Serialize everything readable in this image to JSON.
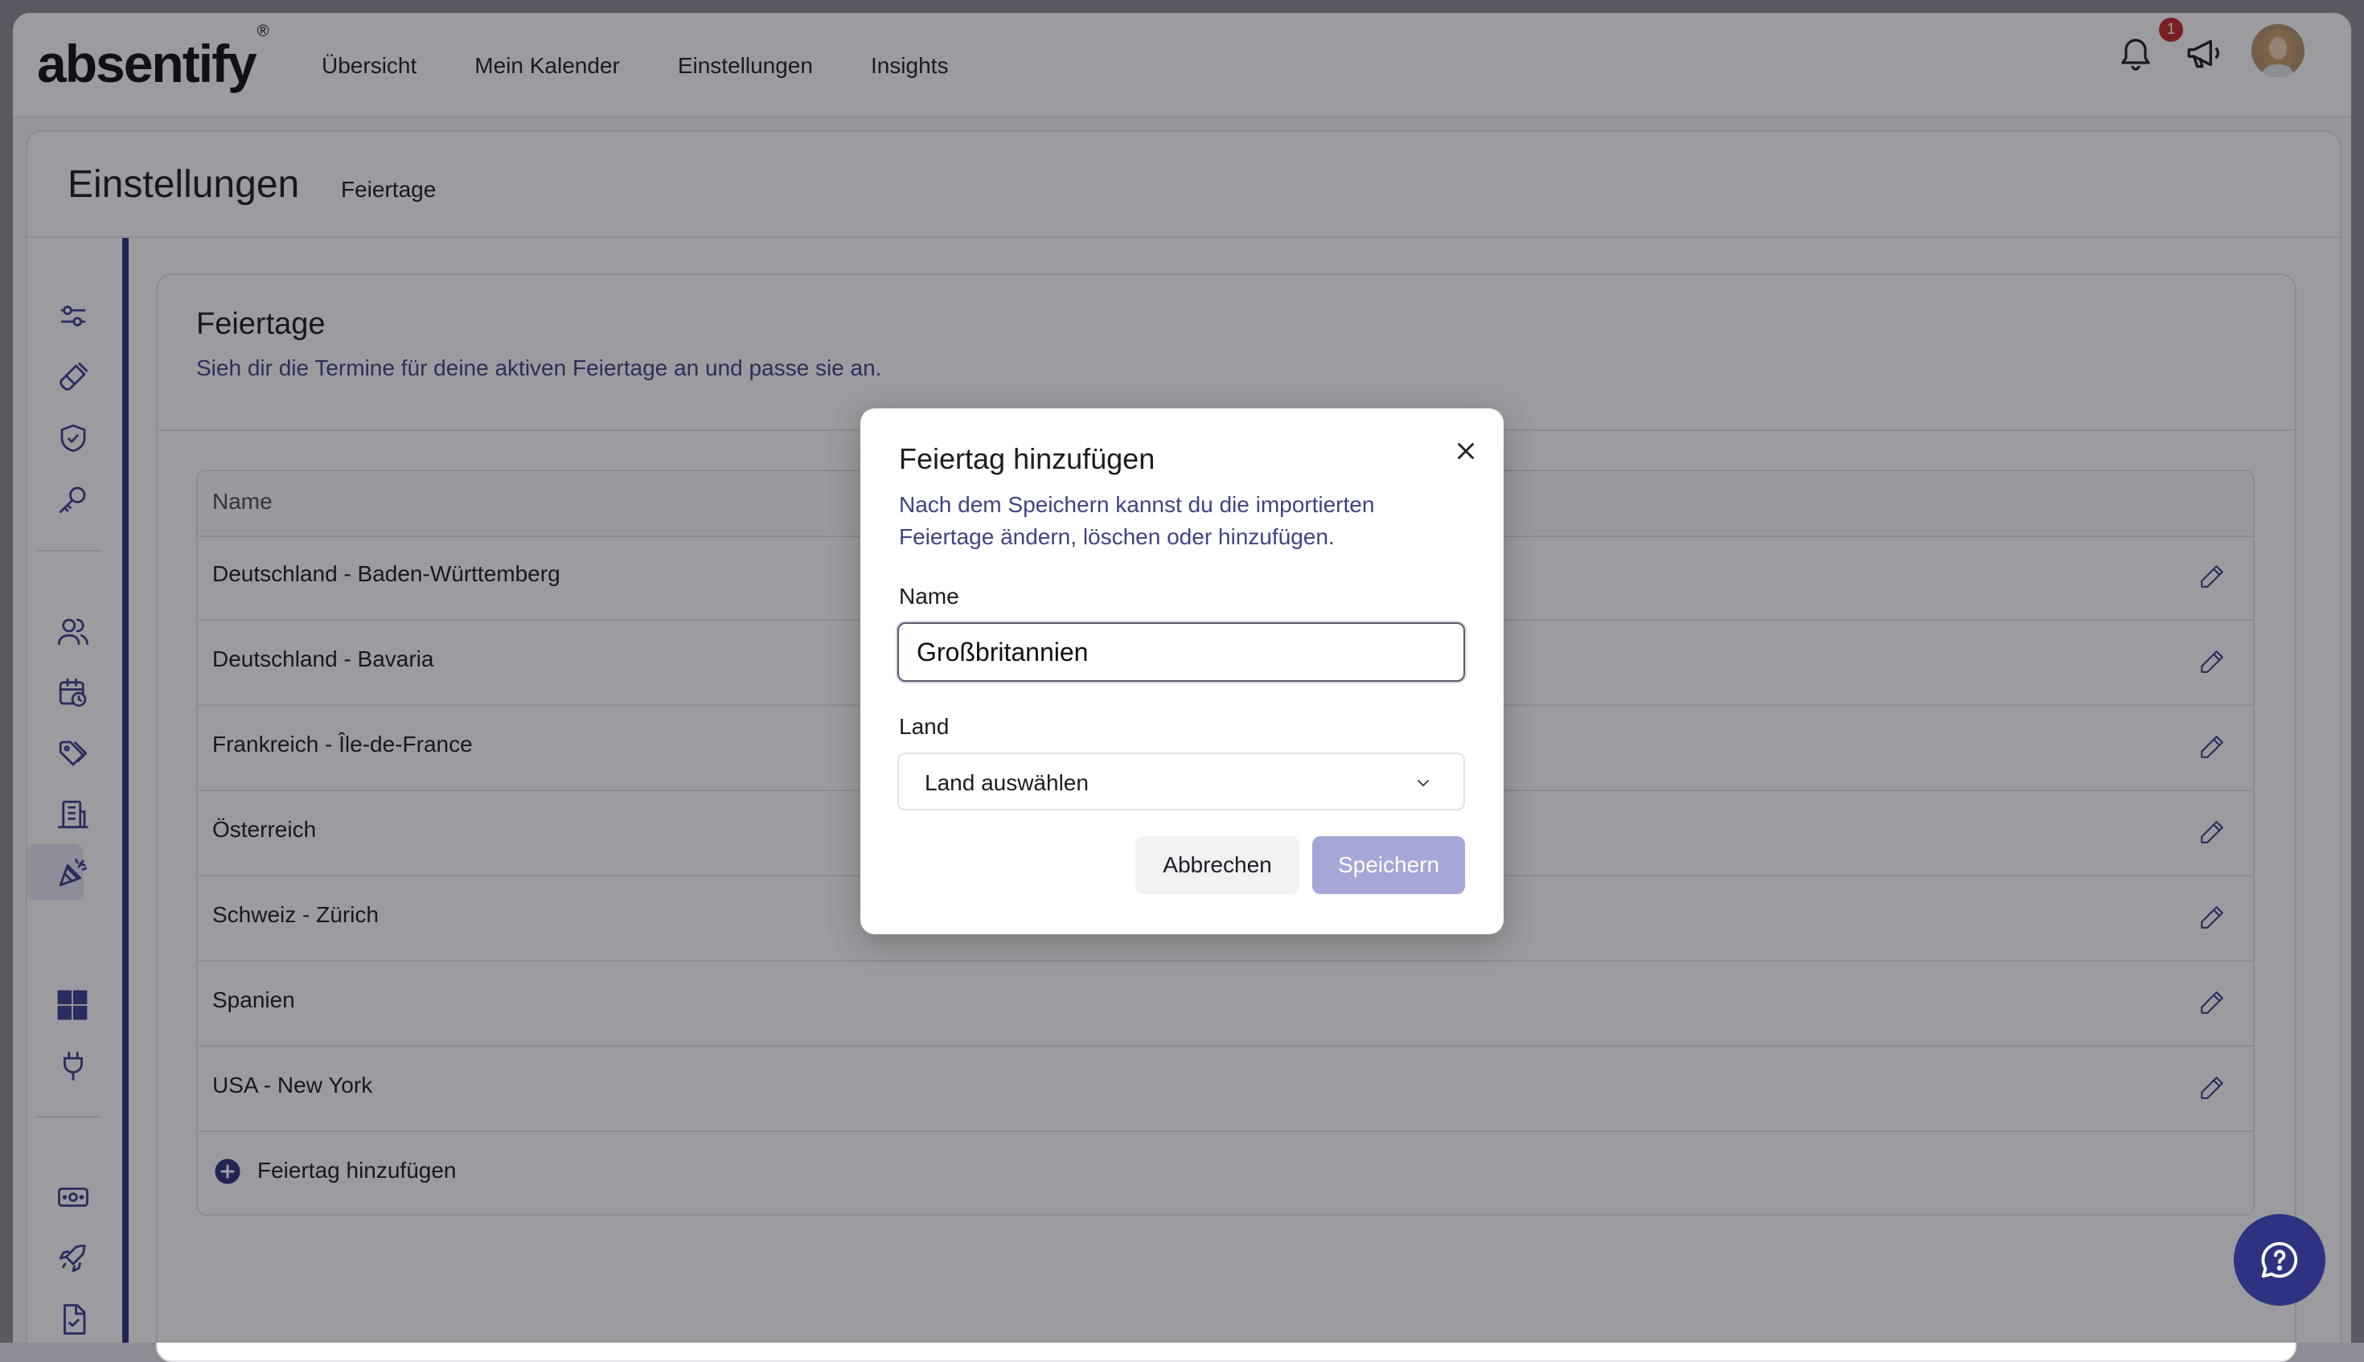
{
  "brand": {
    "logo_text": "absentify",
    "registered_mark": "®"
  },
  "nav": {
    "items": [
      "Übersicht",
      "Mein Kalender",
      "Einstellungen",
      "Insights"
    ]
  },
  "notifications": {
    "count": "1",
    "icon": "bell-icon"
  },
  "page": {
    "title": "Einstellungen",
    "breadcrumb": "Feiertage"
  },
  "sidebar": {
    "icons": [
      "sliders-icon",
      "brush-icon",
      "shield-icon",
      "key-icon",
      "users-icon",
      "calendar-clock-icon",
      "tags-icon",
      "building-icon",
      "party-popper-icon",
      "grid-icon",
      "plug-icon",
      "money-icon",
      "rocket-icon",
      "document-check-icon"
    ],
    "active": "party-popper-icon"
  },
  "card": {
    "title": "Feiertage",
    "subtitle": "Sieh dir die Termine für deine aktiven Feiertage an und passe sie an.",
    "table_header": "Name",
    "rows": [
      "Deutschland - Baden-Württemberg",
      "Deutschland - Bavaria",
      "Frankreich - Île-de-France",
      "Österreich",
      "Schweiz - Zürich",
      "Spanien",
      "USA - New York"
    ],
    "add_label": "Feiertag hinzufügen"
  },
  "modal": {
    "title": "Feiertag hinzufügen",
    "description": "Nach dem Speichern kannst du die importierten Feiertage ändern, löschen oder hinzufügen.",
    "name_label": "Name",
    "name_value": "Großbritannien",
    "country_label": "Land",
    "country_placeholder": "Land auswählen",
    "cancel_label": "Abbrechen",
    "save_label": "Speichern"
  },
  "colors": {
    "accent": "#2f3280",
    "save_disabled": "#a5a7d6",
    "subtitle": "#3f4482",
    "badge": "#c62828"
  }
}
